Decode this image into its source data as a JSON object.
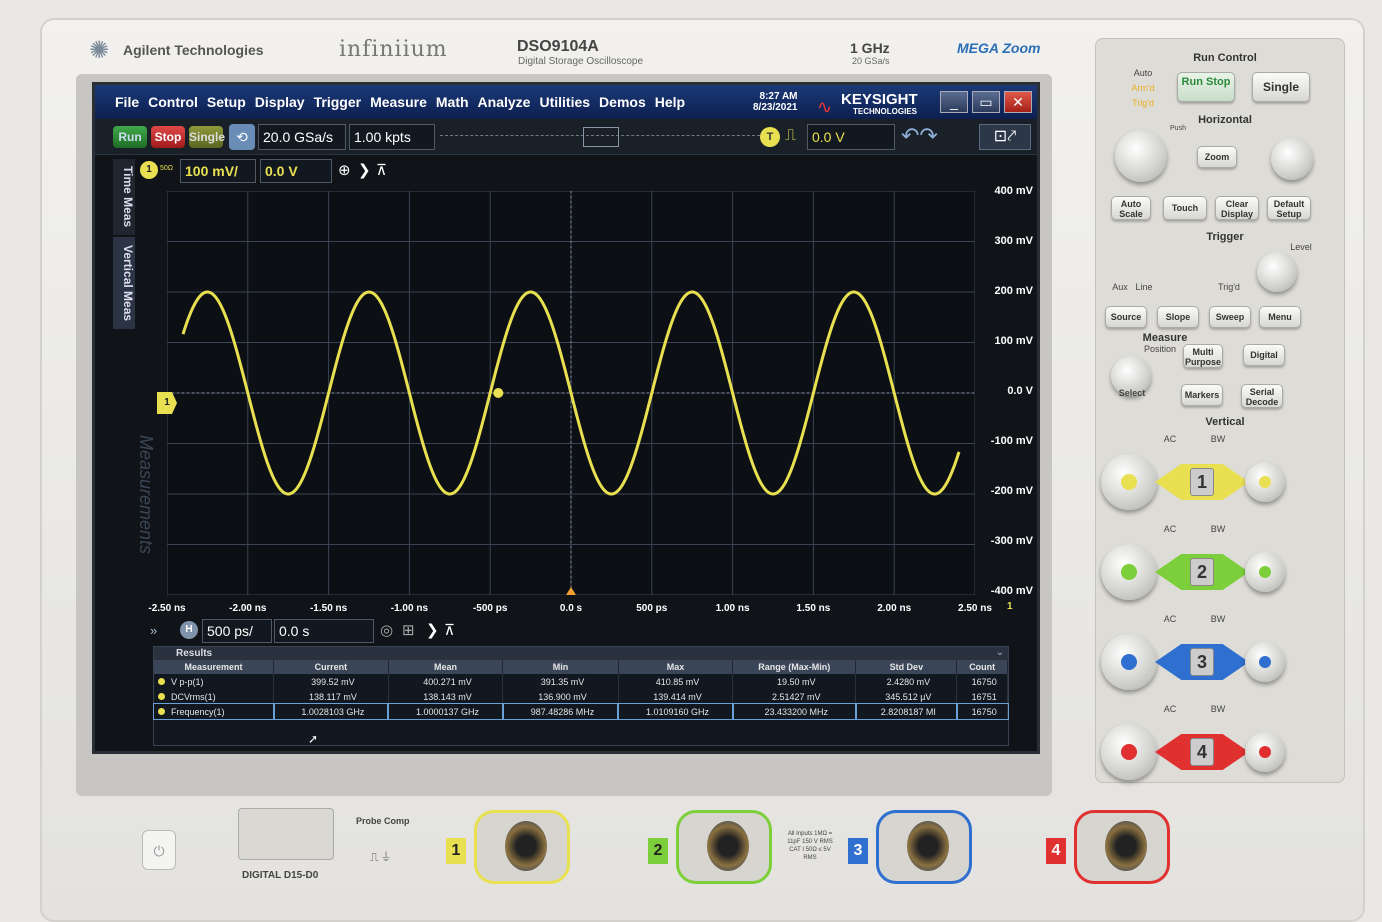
{
  "brand": {
    "company": "Agilent Technologies",
    "series": "infiniium",
    "model": "DSO9104A",
    "model_desc": "Digital Storage Oscilloscope",
    "bandwidth": "1 GHz",
    "sample_rate_max": "20 GSa/s",
    "zoom_logo": "MEGA Zoom"
  },
  "menubar": {
    "items": [
      "File",
      "Control",
      "Setup",
      "Display",
      "Trigger",
      "Measure",
      "Math",
      "Analyze",
      "Utilities",
      "Demos",
      "Help"
    ],
    "time": "8:27 AM",
    "date": "8/23/2021",
    "vendor": "KEYSIGHT",
    "vendor_sub": "TECHNOLOGIES"
  },
  "toolbar": {
    "run": "Run",
    "stop": "Stop",
    "single": "Single",
    "sample_rate": "20.0 GSa/s",
    "memory_depth": "1.00 kpts",
    "trigger_level": "0.0 V",
    "trigger_source_badge": "T"
  },
  "channel1": {
    "badge": "1",
    "impedance": "50Ω",
    "scale": "100 mV/",
    "offset": "0.0 V"
  },
  "side_tabs": [
    "Time Meas",
    "Vertical Meas"
  ],
  "side_panel_label": "Measurements",
  "horizontal": {
    "badge": "H",
    "scale": "500 ps/",
    "position": "0.0 s"
  },
  "axis": {
    "y_ticks": [
      "400 mV",
      "300 mV",
      "200 mV",
      "100 mV",
      "0.0 V",
      "-100 mV",
      "-200 mV",
      "-300 mV",
      "-400 mV"
    ],
    "x_ticks": [
      "-2.50 ns",
      "-2.00 ns",
      "-1.50 ns",
      "-1.00 ns",
      "-500 ps",
      "0.0 s",
      "500 ps",
      "1.00 ns",
      "1.50 ns",
      "2.00 ns",
      "2.50 ns"
    ],
    "x_end_marker": "1"
  },
  "waveform": {
    "amplitude_mv": 200,
    "frequency_ghz": 1.0,
    "color": "#e8e050"
  },
  "results": {
    "title": "Results",
    "headers": [
      "Measurement",
      "Current",
      "Mean",
      "Min",
      "Max",
      "Range (Max-Min)",
      "Std Dev",
      "Count"
    ],
    "rows": [
      [
        "V p-p(1)",
        "399.52 mV",
        "400.271 mV",
        "391.35 mV",
        "410.85 mV",
        "19.50 mV",
        "2.4280 mV",
        "16750"
      ],
      [
        "DCVrms(1)",
        "138.117 mV",
        "138.143 mV",
        "136.900 mV",
        "139.414 mV",
        "2.51427 mV",
        "345.512 µV",
        "16751"
      ],
      [
        "Frequency(1)",
        "1.0028103 GHz",
        "1.0000137 GHz",
        "987.48286 MHz",
        "1.0109160 GHz",
        "23.433200 MHz",
        "2.8208187 MI",
        "16750"
      ]
    ]
  },
  "panel": {
    "run_control": "Run Control",
    "auto": "Auto",
    "armed": "Arm'd",
    "trigd": "Trig'd",
    "run_stop": "Run Stop",
    "single": "Single",
    "horizontal": "Horizontal",
    "push": "Push",
    "zoom": "Zoom",
    "auto_scale": "Auto Scale",
    "touch": "Touch",
    "clear_display": "Clear Display",
    "default_setup": "Default Setup",
    "trigger": "Trigger",
    "level": "Level",
    "aux": "Aux",
    "line": "Line",
    "trig_d": "Trig'd",
    "source": "Source",
    "slope": "Slope",
    "sweep": "Sweep",
    "menu": "Menu",
    "measure": "Measure",
    "position": "Position",
    "multi_purpose": "Multi Purpose",
    "digital": "Digital",
    "select": "Select",
    "markers": "Markers",
    "serial_decode": "Serial Decode",
    "vertical": "Vertical",
    "ac": "AC",
    "bw": "BW",
    "channels": [
      "1",
      "2",
      "3",
      "4"
    ]
  },
  "front": {
    "digital": "DIGITAL D15-D0",
    "probe_comp": "Probe Comp",
    "inputs_warning": "All Inputs 1MΩ = 11pF 150 V RMS CAT I 50Ω ≤ 5V RMS",
    "channel_labels": [
      "1",
      "2",
      "3",
      "4"
    ]
  },
  "colors": {
    "ch1": "#e8e050",
    "ch2": "#7ccf3a",
    "ch3": "#2f6fd0",
    "ch4": "#e03030"
  }
}
